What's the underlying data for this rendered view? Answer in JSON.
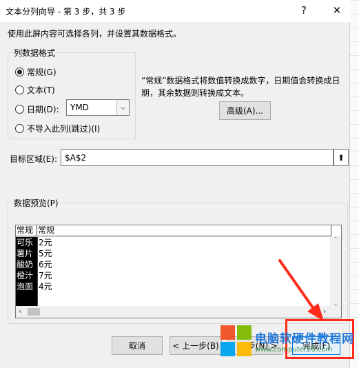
{
  "window": {
    "title": "文本分列向导 - 第 3 步，共 3 步",
    "help_glyph": "?",
    "close_glyph": "✕"
  },
  "instruction": "使用此屏内容可选择各列，并设置其数据格式。",
  "column_format": {
    "legend": "列数据格式",
    "options": [
      {
        "label": "常规(G)",
        "selected": true
      },
      {
        "label": "文本(T)",
        "selected": false
      },
      {
        "label": "日期(D):",
        "selected": false
      },
      {
        "label": "不导入此列(跳过)(I)",
        "selected": false
      }
    ],
    "date_format": {
      "value": "YMD",
      "arrow": "⌵"
    },
    "description": "“常规”数据格式将数值转换成数字，日期值会转换成日期，其余数据则转换成文本。",
    "advanced_label": "高级(A)..."
  },
  "target": {
    "label": "目标区域(E):",
    "value": "$A$2",
    "collapse_glyph": "⬆"
  },
  "preview": {
    "legend": "数据预览(P)",
    "headers": [
      "常规",
      "常规"
    ],
    "col1": [
      "可乐",
      "薯片",
      "酸奶",
      "橙汁",
      "泡面"
    ],
    "col2": [
      "2元",
      "5元",
      "6元",
      "7元",
      "4元"
    ]
  },
  "buttons": {
    "cancel": "取消",
    "back": "< 上一步(B)",
    "next": "步(N) >",
    "finish": "完成(F)"
  },
  "watermark": {
    "main": "电脑软硬件教程网",
    "sub": "www.computer26.com"
  },
  "colors": {
    "highlight_red": "#ff2a1a",
    "watermark_blue": "#1a73d9"
  }
}
